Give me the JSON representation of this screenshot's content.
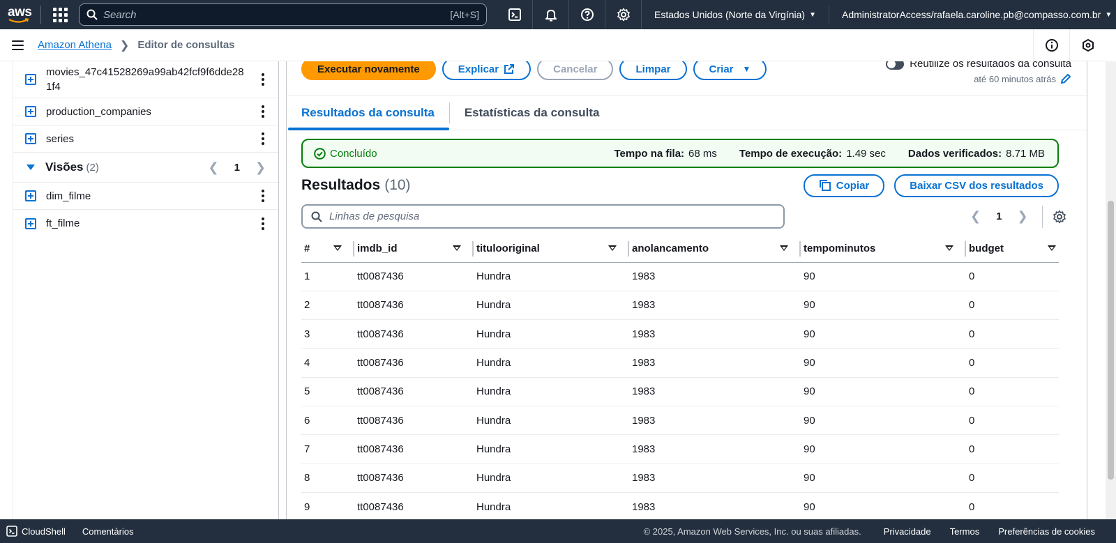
{
  "topnav": {
    "logo_text": "aws",
    "search_placeholder": "Search",
    "search_shortcut": "[Alt+S]",
    "region": "Estados Unidos (Norte da Virgínia)",
    "account": "AdministratorAccess/rafaela.caroline.pb@compasso.com.br"
  },
  "breadcrumb": {
    "service": "Amazon Athena",
    "current": "Editor de consultas"
  },
  "sidebar": {
    "tables": [
      {
        "name": "movies_47c41528269a99ab42fcf9f6dde281f4"
      },
      {
        "name": "production_companies"
      },
      {
        "name": "series"
      }
    ],
    "views": {
      "title": "Visões",
      "count": "(2)",
      "page": "1",
      "items": [
        {
          "name": "dim_filme"
        },
        {
          "name": "ft_filme"
        }
      ]
    }
  },
  "actions": {
    "run_again": "Executar novamente",
    "explain": "Explicar",
    "cancel": "Cancelar",
    "clear": "Limpar",
    "create": "Criar"
  },
  "reuse": {
    "label": "Reutilize os resultados da consulta",
    "sublabel": "até 60 minutos atrás"
  },
  "tabs": [
    {
      "label": "Resultados da consulta"
    },
    {
      "label": "Estatísticas da consulta"
    }
  ],
  "status": {
    "state": "Concluído",
    "queue_label": "Tempo na fila:",
    "queue_value": "68 ms",
    "exec_label": "Tempo de execução:",
    "exec_value": "1.49 sec",
    "scanned_label": "Dados verificados:",
    "scanned_value": "8.71 MB"
  },
  "results": {
    "title": "Resultados",
    "count": "(10)",
    "copy": "Copiar",
    "download": "Baixar CSV dos resultados",
    "filter_placeholder": "Linhas de pesquisa",
    "page": "1",
    "columns": [
      "#",
      "imdb_id",
      "titulooriginal",
      "anolancamento",
      "tempominutos",
      "budget"
    ],
    "rows": [
      [
        "1",
        "tt0087436",
        "Hundra",
        "1983",
        "90",
        "0"
      ],
      [
        "2",
        "tt0087436",
        "Hundra",
        "1983",
        "90",
        "0"
      ],
      [
        "3",
        "tt0087436",
        "Hundra",
        "1983",
        "90",
        "0"
      ],
      [
        "4",
        "tt0087436",
        "Hundra",
        "1983",
        "90",
        "0"
      ],
      [
        "5",
        "tt0087436",
        "Hundra",
        "1983",
        "90",
        "0"
      ],
      [
        "6",
        "tt0087436",
        "Hundra",
        "1983",
        "90",
        "0"
      ],
      [
        "7",
        "tt0087436",
        "Hundra",
        "1983",
        "90",
        "0"
      ],
      [
        "8",
        "tt0087436",
        "Hundra",
        "1983",
        "90",
        "0"
      ],
      [
        "9",
        "tt0087436",
        "Hundra",
        "1983",
        "90",
        "0"
      ]
    ]
  },
  "footer": {
    "cloudshell": "CloudShell",
    "comments": "Comentários",
    "copyright": "© 2025, Amazon Web Services, Inc. ou suas afiliadas.",
    "privacy": "Privacidade",
    "terms": "Termos",
    "cookies": "Preferências de cookies"
  },
  "colors": {
    "nav_bg": "#232f3e",
    "link": "#0972d3",
    "primary_button": "#ff9900",
    "success": "#037f0c"
  }
}
